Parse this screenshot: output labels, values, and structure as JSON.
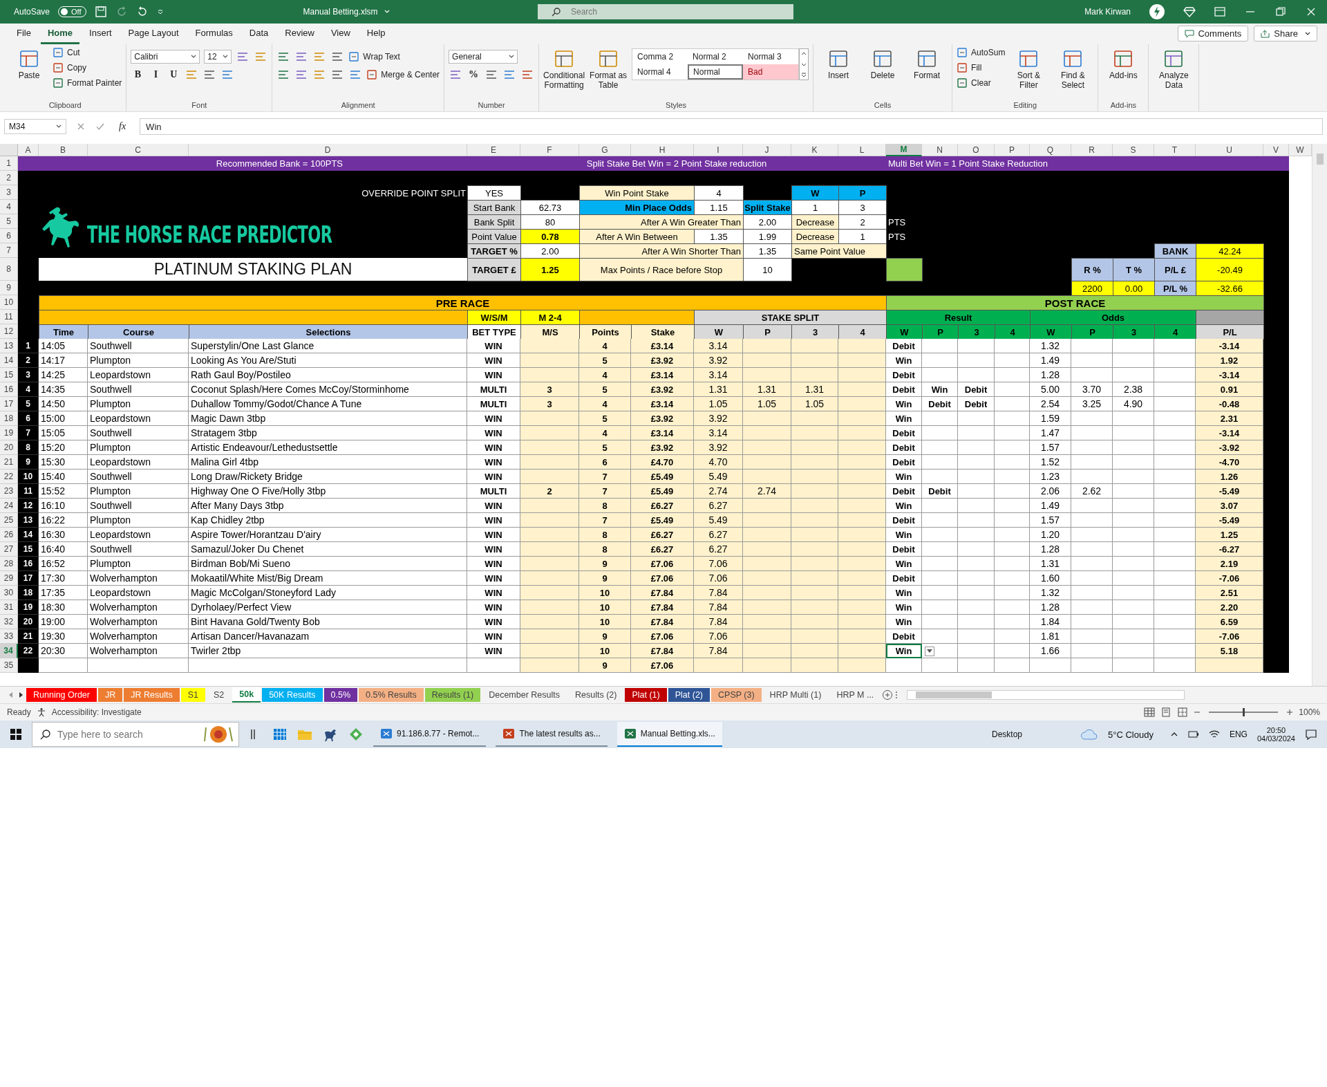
{
  "title_bar": {
    "autosave": "AutoSave",
    "autosave_toggle": {
      "label": "Off",
      "on": false
    },
    "file_name": "Manual Betting.xlsm",
    "search_placeholder": "Search",
    "user_name": "Mark Kirwan"
  },
  "menu_tabs": [
    {
      "label": "File",
      "selected": false
    },
    {
      "label": "Home",
      "selected": true
    },
    {
      "label": "Insert",
      "selected": false
    },
    {
      "label": "Page Layout",
      "selected": false
    },
    {
      "label": "Formulas",
      "selected": false
    },
    {
      "label": "Data",
      "selected": false
    },
    {
      "label": "Review",
      "selected": false
    },
    {
      "label": "View",
      "selected": false
    },
    {
      "label": "Help",
      "selected": false
    }
  ],
  "comments_button": "Comments",
  "share_button": "Share",
  "ribbon": [
    {
      "label": "Clipboard",
      "kind": "columns",
      "lines": [
        [
          {
            "kind": "big",
            "label": "Paste"
          }
        ],
        [
          {
            "kind": "small",
            "label": "Cut"
          },
          {
            "kind": "small",
            "label": "Copy"
          },
          {
            "kind": "small",
            "label": "Format Painter"
          }
        ]
      ]
    },
    {
      "label": "Font",
      "kind": "rows",
      "lines": [
        [
          {
            "kind": "dropdown",
            "label": "Calibri"
          },
          {
            "kind": "dropdown",
            "label": "12"
          },
          {
            "kind": "icon"
          },
          {
            "kind": "icon"
          }
        ],
        [
          {
            "kind": "glyph",
            "label": "B"
          },
          {
            "kind": "glyph",
            "label": "I"
          },
          {
            "kind": "glyph",
            "label": "U"
          },
          {
            "kind": "icon"
          },
          {
            "kind": "icon"
          },
          {
            "kind": "icon"
          }
        ]
      ]
    },
    {
      "label": "Alignment",
      "kind": "rows",
      "lines": [
        [
          {
            "kind": "icon"
          },
          {
            "kind": "icon"
          },
          {
            "kind": "icon"
          },
          {
            "kind": "icon"
          },
          {
            "kind": "small",
            "label": "Wrap Text"
          }
        ],
        [
          {
            "kind": "icon"
          },
          {
            "kind": "icon"
          },
          {
            "kind": "icon"
          },
          {
            "kind": "icon"
          },
          {
            "kind": "icon"
          },
          {
            "kind": "small",
            "label": "Merge & Center"
          }
        ]
      ]
    },
    {
      "label": "Number",
      "kind": "rows",
      "lines": [
        [
          {
            "kind": "dropdown",
            "label": "General"
          }
        ],
        [
          {
            "kind": "icon"
          },
          {
            "kind": "glyph",
            "label": "%"
          },
          {
            "kind": "icon"
          },
          {
            "kind": "icon"
          },
          {
            "kind": "icon"
          }
        ]
      ]
    },
    {
      "label": "Styles",
      "kind": "columns",
      "lines": [
        [
          {
            "kind": "big",
            "label": "Conditional Formatting"
          }
        ],
        [
          {
            "kind": "big",
            "label": "Format as Table"
          }
        ],
        [
          {
            "kind": "gallery"
          }
        ]
      ]
    },
    {
      "label": "Cells",
      "kind": "columns",
      "lines": [
        [
          {
            "kind": "big",
            "label": "Insert"
          }
        ],
        [
          {
            "kind": "big",
            "label": "Delete"
          }
        ],
        [
          {
            "kind": "big",
            "label": "Format"
          }
        ]
      ]
    },
    {
      "label": "Editing",
      "kind": "columns",
      "lines": [
        [
          {
            "kind": "small",
            "label": "AutoSum"
          },
          {
            "kind": "small",
            "label": "Fill"
          },
          {
            "kind": "small",
            "label": "Clear"
          }
        ],
        [
          {
            "kind": "big",
            "label": "Sort & Filter"
          }
        ],
        [
          {
            "kind": "big",
            "label": "Find & Select"
          }
        ]
      ]
    },
    {
      "label": "Add-ins",
      "kind": "columns",
      "lines": [
        [
          {
            "kind": "big",
            "label": "Add-ins"
          }
        ]
      ]
    },
    {
      "kind": "columns",
      "lines": [
        [
          {
            "kind": "big",
            "label": "Analyze Data"
          }
        ]
      ]
    }
  ],
  "styles_gallery": [
    {
      "label": "Comma 2",
      "kind": "plain",
      "selected": false
    },
    {
      "label": "Normal 2",
      "kind": "plain",
      "selected": false
    },
    {
      "label": "Normal 3",
      "kind": "plain",
      "selected": false
    },
    {
      "label": "Normal 4",
      "kind": "plain",
      "selected": false
    },
    {
      "label": "Normal",
      "kind": "plain",
      "selected": true
    },
    {
      "label": "Bad",
      "kind": "bad",
      "selected": false
    }
  ],
  "formula_bar": {
    "name_box": "M34",
    "fx": "fx",
    "value": "Win"
  },
  "sheet": {
    "columns": [
      {
        "label": "A",
        "selected": false
      },
      {
        "label": "B",
        "selected": false
      },
      {
        "label": "C",
        "selected": false
      },
      {
        "label": "D",
        "selected": false
      },
      {
        "label": "E",
        "selected": false
      },
      {
        "label": "F",
        "selected": false
      },
      {
        "label": "G",
        "selected": false
      },
      {
        "label": "H",
        "selected": false
      },
      {
        "label": "I",
        "selected": false
      },
      {
        "label": "J",
        "selected": false
      },
      {
        "label": "K",
        "selected": false
      },
      {
        "label": "L",
        "selected": false
      },
      {
        "label": "M",
        "selected": true
      },
      {
        "label": "N",
        "selected": false
      },
      {
        "label": "O",
        "selected": false
      },
      {
        "label": "P",
        "selected": false
      },
      {
        "label": "Q",
        "selected": false
      },
      {
        "label": "R",
        "selected": false
      },
      {
        "label": "S",
        "selected": false
      },
      {
        "label": "T",
        "selected": false
      },
      {
        "label": "U",
        "selected": false
      },
      {
        "label": "V",
        "selected": false
      },
      {
        "label": "W",
        "selected": false
      }
    ],
    "row_numbers": [
      {
        "label": "1",
        "selected": false
      },
      {
        "label": "2",
        "selected": false
      },
      {
        "label": "3",
        "selected": false
      },
      {
        "label": "4",
        "selected": false
      },
      {
        "label": "5",
        "selected": false
      },
      {
        "label": "6",
        "selected": false
      },
      {
        "label": "7",
        "selected": false
      },
      {
        "label": "8",
        "selected": false
      },
      {
        "label": "9",
        "selected": false
      },
      {
        "label": "10",
        "selected": false
      },
      {
        "label": "11",
        "selected": false
      },
      {
        "label": "12",
        "selected": false
      },
      {
        "label": "13",
        "selected": false
      },
      {
        "label": "14",
        "selected": false
      },
      {
        "label": "15",
        "selected": false
      },
      {
        "label": "16",
        "selected": false
      },
      {
        "label": "17",
        "selected": false
      },
      {
        "label": "18",
        "selected": false
      },
      {
        "label": "19",
        "selected": false
      },
      {
        "label": "20",
        "selected": false
      },
      {
        "label": "21",
        "selected": false
      },
      {
        "label": "22",
        "selected": false
      },
      {
        "label": "23",
        "selected": false
      },
      {
        "label": "24",
        "selected": false
      },
      {
        "label": "25",
        "selected": false
      },
      {
        "label": "26",
        "selected": false
      },
      {
        "label": "27",
        "selected": false
      },
      {
        "label": "28",
        "selected": false
      },
      {
        "label": "29",
        "selected": false
      },
      {
        "label": "30",
        "selected": false
      },
      {
        "label": "31",
        "selected": false
      },
      {
        "label": "32",
        "selected": false
      },
      {
        "label": "33",
        "selected": false
      },
      {
        "label": "34",
        "selected": true
      },
      {
        "label": "35",
        "selected": false
      }
    ],
    "logo": {
      "title": "THE HORSE RACE PREDICTOR",
      "subtitle": "PLATINUM STAKING PLAN"
    },
    "top_rows": {
      "1": {
        "A:D": {
          "text": "Recommended Bank = 100PTS",
          "kind": "banner-right"
        },
        "E:L": {
          "text": "Split Stake Bet Win = 2 Point Stake reduction",
          "kind": "banner-center"
        },
        "M:V": {
          "text": "Multi Bet Win = 1 Point  Stake Reduction",
          "kind": "banner-left"
        }
      },
      "3": {
        "D": {
          "text": "OVERRIDE POINT SPLIT",
          "kind": "label"
        },
        "E": {
          "text": "YES",
          "kind": "input"
        },
        "G:H": {
          "text": "Win Point Stake",
          "kind": "cream"
        },
        "I": {
          "text": "4",
          "kind": "input"
        },
        "K": {
          "text": "W",
          "kind": "blue"
        },
        "L": {
          "text": "P",
          "kind": "blue"
        }
      },
      "4": {
        "E": {
          "text": "Start Bank",
          "kind": "grey"
        },
        "F": {
          "text": "62.73",
          "kind": "input"
        },
        "G:H": {
          "text": "Min Place Odds",
          "kind": "blue-right"
        },
        "I": {
          "text": "1.15",
          "kind": "input"
        },
        "J": {
          "text": "Split Stake",
          "kind": "blue"
        },
        "K": {
          "text": "1",
          "kind": "input"
        },
        "L": {
          "text": "3",
          "kind": "input"
        }
      },
      "5": {
        "E": {
          "text": "Bank Split",
          "kind": "grey"
        },
        "F": {
          "text": "80",
          "kind": "input"
        },
        "G:I": {
          "text": "After A Win Greater Than",
          "kind": "cream-right"
        },
        "J": {
          "text": "2.00",
          "kind": "input"
        },
        "K": {
          "text": "Decrease",
          "kind": "cream"
        },
        "L": {
          "text": "2",
          "kind": "input"
        },
        "M": {
          "text": "PTS",
          "kind": "note"
        }
      },
      "6": {
        "E": {
          "text": "Point Value",
          "kind": "grey"
        },
        "F": {
          "text": "0.78",
          "kind": "yellow"
        },
        "G:H": {
          "text": "After A Win Between",
          "kind": "cream"
        },
        "I": {
          "text": "1.35",
          "kind": "input"
        },
        "J": {
          "text": "1.99",
          "kind": "input"
        },
        "K": {
          "text": "Decrease",
          "kind": "cream"
        },
        "L": {
          "text": "1",
          "kind": "input"
        },
        "M": {
          "text": "PTS",
          "kind": "note"
        }
      },
      "7": {
        "E": {
          "text": "TARGET %",
          "kind": "grey-bold"
        },
        "F": {
          "text": "2.00",
          "kind": "input"
        },
        "G:I": {
          "text": "After A Win Shorter Than",
          "kind": "cream-right"
        },
        "J": {
          "text": "1.35",
          "kind": "input"
        },
        "K:L": {
          "text": "Same Point Value",
          "kind": "cream-left"
        },
        "T": {
          "text": "BANK",
          "kind": "slate"
        },
        "U": {
          "text": "42.24",
          "kind": "yellow-plain"
        }
      },
      "8": {
        "E": {
          "text": "TARGET £",
          "kind": "grey-bold"
        },
        "F": {
          "text": "1.25",
          "kind": "yellow"
        },
        "G:I": {
          "text": "Max Points / Race before Stop",
          "kind": "cream"
        },
        "J": {
          "text": "10",
          "kind": "input"
        },
        "M": {
          "kind": "lime"
        },
        "R": {
          "text": "R %",
          "kind": "slate"
        },
        "S": {
          "text": "T %",
          "kind": "slate"
        },
        "T": {
          "text": "P/L £",
          "kind": "slate"
        },
        "U": {
          "text": "-20.49",
          "kind": "yellow-plain"
        }
      },
      "9": {
        "R": {
          "text": "2200",
          "kind": "yellow-plain"
        },
        "S": {
          "text": "0.00",
          "kind": "yellow-plain"
        },
        "T": {
          "text": "P/L %",
          "kind": "slate"
        },
        "U": {
          "text": "-32.66",
          "kind": "yellow-plain"
        }
      },
      "10": {
        "B:L": {
          "text": "PRE RACE",
          "kind": "orange-title"
        },
        "M:U": {
          "text": "POST RACE",
          "kind": "lime-title"
        }
      },
      "11": {
        "B:D": {
          "kind": "orange"
        },
        "E": {
          "text": "W/S/M",
          "kind": "yellow"
        },
        "F": {
          "text": "M 2-4",
          "kind": "yellow"
        },
        "G:H": {
          "kind": "orange"
        },
        "I:L": {
          "text": "STAKE SPLIT",
          "kind": "silver"
        },
        "M:P": {
          "text": "Result",
          "kind": "green"
        },
        "Q:T": {
          "text": "Odds",
          "kind": "green"
        },
        "U": {
          "kind": "dim"
        }
      },
      "12": {
        "B": {
          "text": "Time",
          "kind": "slate"
        },
        "C": {
          "text": "Course",
          "kind": "slate"
        },
        "D": {
          "text": "Selections",
          "kind": "slate"
        },
        "E": {
          "text": "BET TYPE",
          "kind": "white-bold"
        },
        "F": {
          "text": "M/S",
          "kind": "cream-bold"
        },
        "G": {
          "text": "Points",
          "kind": "cream-bold"
        },
        "H": {
          "text": "Stake",
          "kind": "cream-bold"
        },
        "I": {
          "text": "W",
          "kind": "silver"
        },
        "J": {
          "text": "P",
          "kind": "silver"
        },
        "K": {
          "text": "3",
          "kind": "silver"
        },
        "L": {
          "text": "4",
          "kind": "silver"
        },
        "M": {
          "text": "W",
          "kind": "green"
        },
        "N": {
          "text": "P",
          "kind": "green"
        },
        "O": {
          "text": "3",
          "kind": "green"
        },
        "P": {
          "text": "4",
          "kind": "green"
        },
        "Q": {
          "text": "W",
          "kind": "green"
        },
        "R": {
          "text": "P",
          "kind": "green"
        },
        "S": {
          "text": "3",
          "kind": "green"
        },
        "T": {
          "text": "4",
          "kind": "green"
        },
        "U": {
          "text": "P/L",
          "kind": "silver"
        }
      }
    },
    "rows": [
      {
        "n": "1",
        "time": "14:05",
        "course": "Southwell",
        "selections": "Superstylin/One Last Glance",
        "bet_type": "WIN",
        "units": "4",
        "stake": "£3.14",
        "split": [
          "3.14"
        ],
        "result": [
          "Debit"
        ],
        "odds": [
          "1.32"
        ],
        "pl": "-3.14",
        "selected": false
      },
      {
        "n": "2",
        "time": "14:17",
        "course": "Plumpton",
        "selections": "Looking As You Are/Stuti",
        "bet_type": "WIN",
        "units": "5",
        "stake": "£3.92",
        "split": [
          "3.92"
        ],
        "result": [
          "Win"
        ],
        "odds": [
          "1.49"
        ],
        "pl": "1.92",
        "selected": false
      },
      {
        "n": "3",
        "time": "14:25",
        "course": "Leopardstown",
        "selections": "Rath Gaul Boy/Postileo",
        "bet_type": "WIN",
        "units": "4",
        "stake": "£3.14",
        "split": [
          "3.14"
        ],
        "result": [
          "Debit"
        ],
        "odds": [
          "1.28"
        ],
        "pl": "-3.14",
        "selected": false
      },
      {
        "n": "4",
        "time": "14:35",
        "course": "Southwell",
        "selections": "Coconut Splash/Here Comes McCoy/Storminhome",
        "bet_type": "MULTI",
        "ms": "3",
        "units": "5",
        "stake": "£3.92",
        "split": [
          "1.31",
          "1.31",
          "1.31"
        ],
        "result": [
          "Debit",
          "Win",
          "Debit"
        ],
        "odds": [
          "5.00",
          "3.70",
          "2.38"
        ],
        "pl": "0.91",
        "selected": false
      },
      {
        "n": "5",
        "time": "14:50",
        "course": "Plumpton",
        "selections": "Duhallow Tommy/Godot/Chance A Tune",
        "bet_type": "MULTI",
        "ms": "3",
        "units": "4",
        "stake": "£3.14",
        "split": [
          "1.05",
          "1.05",
          "1.05"
        ],
        "result": [
          "Win",
          "Debit",
          "Debit"
        ],
        "odds": [
          "2.54",
          "3.25",
          "4.90"
        ],
        "pl": "-0.48",
        "selected": false
      },
      {
        "n": "6",
        "time": "15:00",
        "course": "Leopardstown",
        "selections": "Magic Dawn 3tbp",
        "bet_type": "WIN",
        "units": "5",
        "stake": "£3.92",
        "split": [
          "3.92"
        ],
        "result": [
          "Win"
        ],
        "odds": [
          "1.59"
        ],
        "pl": "2.31",
        "selected": false
      },
      {
        "n": "7",
        "time": "15:05",
        "course": "Southwell",
        "selections": "Stratagem 3tbp",
        "bet_type": "WIN",
        "units": "4",
        "stake": "£3.14",
        "split": [
          "3.14"
        ],
        "result": [
          "Debit"
        ],
        "odds": [
          "1.47"
        ],
        "pl": "-3.14",
        "selected": false
      },
      {
        "n": "8",
        "time": "15:20",
        "course": "Plumpton",
        "selections": "Artistic Endeavour/Lethedustsettle",
        "bet_type": "WIN",
        "units": "5",
        "stake": "£3.92",
        "split": [
          "3.92"
        ],
        "result": [
          "Debit"
        ],
        "odds": [
          "1.57"
        ],
        "pl": "-3.92",
        "selected": false
      },
      {
        "n": "9",
        "time": "15:30",
        "course": "Leopardstown",
        "selections": "Malina Girl 4tbp",
        "bet_type": "WIN",
        "units": "6",
        "stake": "£4.70",
        "split": [
          "4.70"
        ],
        "result": [
          "Debit"
        ],
        "odds": [
          "1.52"
        ],
        "pl": "-4.70",
        "selected": false
      },
      {
        "n": "10",
        "time": "15:40",
        "course": "Southwell",
        "selections": "Long Draw/Rickety Bridge",
        "bet_type": "WIN",
        "units": "7",
        "stake": "£5.49",
        "split": [
          "5.49"
        ],
        "result": [
          "Win"
        ],
        "odds": [
          "1.23"
        ],
        "pl": "1.26",
        "selected": false
      },
      {
        "n": "11",
        "time": "15:52",
        "course": "Plumpton",
        "selections": "Highway One O Five/Holly 3tbp",
        "bet_type": "MULTI",
        "ms": "2",
        "units": "7",
        "stake": "£5.49",
        "split": [
          "2.74",
          "2.74"
        ],
        "result": [
          "Debit",
          "Debit"
        ],
        "odds": [
          "2.06",
          "2.62"
        ],
        "pl": "-5.49",
        "selected": false
      },
      {
        "n": "12",
        "time": "16:10",
        "course": "Southwell",
        "selections": "After Many Days 3tbp",
        "bet_type": "WIN",
        "units": "8",
        "stake": "£6.27",
        "split": [
          "6.27"
        ],
        "result": [
          "Win"
        ],
        "odds": [
          "1.49"
        ],
        "pl": "3.07",
        "selected": false
      },
      {
        "n": "13",
        "time": "16:22",
        "course": "Plumpton",
        "selections": "Kap Chidley 2tbp",
        "bet_type": "WIN",
        "units": "7",
        "stake": "£5.49",
        "split": [
          "5.49"
        ],
        "result": [
          "Debit"
        ],
        "odds": [
          "1.57"
        ],
        "pl": "-5.49",
        "selected": false
      },
      {
        "n": "14",
        "time": "16:30",
        "course": "Leopardstown",
        "selections": "Aspire Tower/Horantzau D'airy",
        "bet_type": "WIN",
        "units": "8",
        "stake": "£6.27",
        "split": [
          "6.27"
        ],
        "result": [
          "Win"
        ],
        "odds": [
          "1.20"
        ],
        "pl": "1.25",
        "selected": false
      },
      {
        "n": "15",
        "time": "16:40",
        "course": "Southwell",
        "selections": "Samazul/Joker Du Chenet",
        "bet_type": "WIN",
        "units": "8",
        "stake": "£6.27",
        "split": [
          "6.27"
        ],
        "result": [
          "Debit"
        ],
        "odds": [
          "1.28"
        ],
        "pl": "-6.27",
        "selected": false
      },
      {
        "n": "16",
        "time": "16:52",
        "course": "Plumpton",
        "selections": "Birdman Bob/Mi Sueno",
        "bet_type": "WIN",
        "units": "9",
        "stake": "£7.06",
        "split": [
          "7.06"
        ],
        "result": [
          "Win"
        ],
        "odds": [
          "1.31"
        ],
        "pl": "2.19",
        "selected": false
      },
      {
        "n": "17",
        "time": "17:30",
        "course": "Wolverhampton",
        "selections": "Mokaatil/White Mist/Big Dream",
        "bet_type": "WIN",
        "units": "9",
        "stake": "£7.06",
        "split": [
          "7.06"
        ],
        "result": [
          "Debit"
        ],
        "odds": [
          "1.60"
        ],
        "pl": "-7.06",
        "selected": false
      },
      {
        "n": "18",
        "time": "17:35",
        "course": "Leopardstown",
        "selections": "Magic McColgan/Stoneyford Lady",
        "bet_type": "WIN",
        "units": "10",
        "stake": "£7.84",
        "split": [
          "7.84"
        ],
        "result": [
          "Win"
        ],
        "odds": [
          "1.32"
        ],
        "pl": "2.51",
        "selected": false
      },
      {
        "n": "19",
        "time": "18:30",
        "course": "Wolverhampton",
        "selections": "Dyrholaey/Perfect View",
        "bet_type": "WIN",
        "units": "10",
        "stake": "£7.84",
        "split": [
          "7.84"
        ],
        "result": [
          "Win"
        ],
        "odds": [
          "1.28"
        ],
        "pl": "2.20",
        "selected": false
      },
      {
        "n": "20",
        "time": "19:00",
        "course": "Wolverhampton",
        "selections": "Bint Havana Gold/Twenty Bob",
        "bet_type": "WIN",
        "units": "10",
        "stake": "£7.84",
        "split": [
          "7.84"
        ],
        "result": [
          "Win"
        ],
        "odds": [
          "1.84"
        ],
        "pl": "6.59",
        "selected": false
      },
      {
        "n": "21",
        "time": "19:30",
        "course": "Wolverhampton",
        "selections": "Artisan Dancer/Havanazam",
        "bet_type": "WIN",
        "units": "9",
        "stake": "£7.06",
        "split": [
          "7.06"
        ],
        "result": [
          "Debit"
        ],
        "odds": [
          "1.81"
        ],
        "pl": "-7.06",
        "selected": false
      },
      {
        "n": "22",
        "time": "20:30",
        "course": "Wolverhampton",
        "selections": "Twirler 2tbp",
        "bet_type": "WIN",
        "units": "10",
        "stake": "£7.84",
        "split": [
          "7.84"
        ],
        "result": [
          "Win"
        ],
        "odds": [
          "1.66"
        ],
        "pl": "5.18",
        "selected": true
      }
    ],
    "totals": {
      "units": "9",
      "stake": "£7.06"
    }
  },
  "sheet_tabs": [
    {
      "label": "Running Order",
      "color": "#ff0000",
      "selected": false
    },
    {
      "label": "JR",
      "color": "#ed7d31",
      "selected": false
    },
    {
      "label": "JR Results",
      "color": "#ed7d31",
      "selected": false
    },
    {
      "label": "S1",
      "color": "#ffff00",
      "selected": false
    },
    {
      "label": "S2",
      "selected": false
    },
    {
      "label": "50k",
      "selected": true
    },
    {
      "label": "50K Results",
      "color": "#00b0f0",
      "selected": false
    },
    {
      "label": "0.5%",
      "color": "#7030a0",
      "selected": false
    },
    {
      "label": "0.5% Results",
      "color": "#f4b084",
      "selected": false
    },
    {
      "label": "Results (1)",
      "color": "#92d050",
      "selected": false
    },
    {
      "label": "December Results",
      "selected": false
    },
    {
      "label": "Results (2)",
      "selected": false
    },
    {
      "label": "Plat (1)",
      "color": "#c00000",
      "selected": false
    },
    {
      "label": "Plat (2)",
      "color": "#2f5597",
      "selected": false
    },
    {
      "label": "CPSP (3)",
      "color": "#f4b084",
      "selected": false
    },
    {
      "label": "HRP Multi (1)",
      "selected": false
    },
    {
      "label": "HRP M ...",
      "selected": false
    }
  ],
  "status_bar": {
    "state": "Ready",
    "accessibility": "Accessibility: Investigate",
    "zoom": {
      "label": "100%",
      "level": 0.5
    }
  },
  "taskbar": {
    "search_placeholder": "Type here to search",
    "apps": [
      {
        "label": "91.186.8.77 - Remot...",
        "selected": false
      },
      {
        "label": "The latest results as...",
        "selected": false
      },
      {
        "label": "Manual Betting.xls...",
        "selected": true
      }
    ],
    "desktop": "Desktop",
    "weather": "5°C  Cloudy",
    "language": "ENG",
    "time": "20:50",
    "date": "04/03/2024"
  }
}
